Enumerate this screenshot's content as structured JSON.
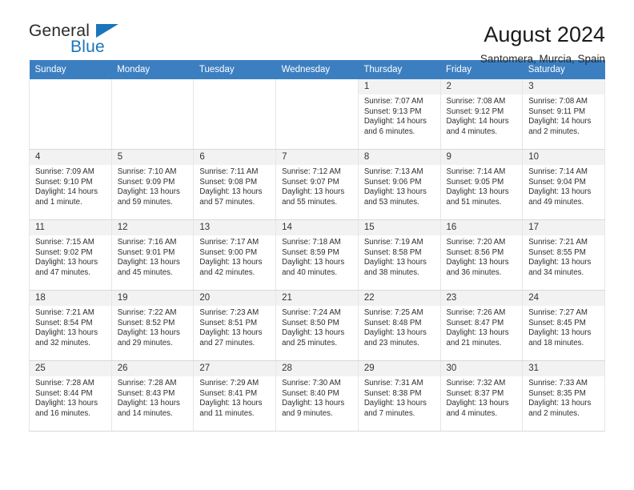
{
  "brand": {
    "word_one": "General",
    "word_two": "Blue",
    "accent_color": "#1b75bb",
    "flag_icon": "brand-flag-icon"
  },
  "header": {
    "title": "August 2024",
    "subtitle": "Santomera, Murcia, Spain",
    "header_bg": "#3c7fc1"
  },
  "calendar": {
    "weekday_headers": [
      "Sunday",
      "Monday",
      "Tuesday",
      "Wednesday",
      "Thursday",
      "Friday",
      "Saturday"
    ],
    "labels": {
      "sunrise": "Sunrise:",
      "sunset": "Sunset:",
      "daylight": "Daylight:"
    },
    "weeks": [
      [
        {
          "day": "",
          "blank": true
        },
        {
          "day": "",
          "blank": true
        },
        {
          "day": "",
          "blank": true
        },
        {
          "day": "",
          "blank": true
        },
        {
          "day": "1",
          "sunrise": "Sunrise: 7:07 AM",
          "sunset": "Sunset: 9:13 PM",
          "daylight_1": "Daylight: 14 hours",
          "daylight_2": "and 6 minutes."
        },
        {
          "day": "2",
          "sunrise": "Sunrise: 7:08 AM",
          "sunset": "Sunset: 9:12 PM",
          "daylight_1": "Daylight: 14 hours",
          "daylight_2": "and 4 minutes."
        },
        {
          "day": "3",
          "sunrise": "Sunrise: 7:08 AM",
          "sunset": "Sunset: 9:11 PM",
          "daylight_1": "Daylight: 14 hours",
          "daylight_2": "and 2 minutes."
        }
      ],
      [
        {
          "day": "4",
          "sunrise": "Sunrise: 7:09 AM",
          "sunset": "Sunset: 9:10 PM",
          "daylight_1": "Daylight: 14 hours",
          "daylight_2": "and 1 minute."
        },
        {
          "day": "5",
          "sunrise": "Sunrise: 7:10 AM",
          "sunset": "Sunset: 9:09 PM",
          "daylight_1": "Daylight: 13 hours",
          "daylight_2": "and 59 minutes."
        },
        {
          "day": "6",
          "sunrise": "Sunrise: 7:11 AM",
          "sunset": "Sunset: 9:08 PM",
          "daylight_1": "Daylight: 13 hours",
          "daylight_2": "and 57 minutes."
        },
        {
          "day": "7",
          "sunrise": "Sunrise: 7:12 AM",
          "sunset": "Sunset: 9:07 PM",
          "daylight_1": "Daylight: 13 hours",
          "daylight_2": "and 55 minutes."
        },
        {
          "day": "8",
          "sunrise": "Sunrise: 7:13 AM",
          "sunset": "Sunset: 9:06 PM",
          "daylight_1": "Daylight: 13 hours",
          "daylight_2": "and 53 minutes."
        },
        {
          "day": "9",
          "sunrise": "Sunrise: 7:14 AM",
          "sunset": "Sunset: 9:05 PM",
          "daylight_1": "Daylight: 13 hours",
          "daylight_2": "and 51 minutes."
        },
        {
          "day": "10",
          "sunrise": "Sunrise: 7:14 AM",
          "sunset": "Sunset: 9:04 PM",
          "daylight_1": "Daylight: 13 hours",
          "daylight_2": "and 49 minutes."
        }
      ],
      [
        {
          "day": "11",
          "sunrise": "Sunrise: 7:15 AM",
          "sunset": "Sunset: 9:02 PM",
          "daylight_1": "Daylight: 13 hours",
          "daylight_2": "and 47 minutes."
        },
        {
          "day": "12",
          "sunrise": "Sunrise: 7:16 AM",
          "sunset": "Sunset: 9:01 PM",
          "daylight_1": "Daylight: 13 hours",
          "daylight_2": "and 45 minutes."
        },
        {
          "day": "13",
          "sunrise": "Sunrise: 7:17 AM",
          "sunset": "Sunset: 9:00 PM",
          "daylight_1": "Daylight: 13 hours",
          "daylight_2": "and 42 minutes."
        },
        {
          "day": "14",
          "sunrise": "Sunrise: 7:18 AM",
          "sunset": "Sunset: 8:59 PM",
          "daylight_1": "Daylight: 13 hours",
          "daylight_2": "and 40 minutes."
        },
        {
          "day": "15",
          "sunrise": "Sunrise: 7:19 AM",
          "sunset": "Sunset: 8:58 PM",
          "daylight_1": "Daylight: 13 hours",
          "daylight_2": "and 38 minutes."
        },
        {
          "day": "16",
          "sunrise": "Sunrise: 7:20 AM",
          "sunset": "Sunset: 8:56 PM",
          "daylight_1": "Daylight: 13 hours",
          "daylight_2": "and 36 minutes."
        },
        {
          "day": "17",
          "sunrise": "Sunrise: 7:21 AM",
          "sunset": "Sunset: 8:55 PM",
          "daylight_1": "Daylight: 13 hours",
          "daylight_2": "and 34 minutes."
        }
      ],
      [
        {
          "day": "18",
          "sunrise": "Sunrise: 7:21 AM",
          "sunset": "Sunset: 8:54 PM",
          "daylight_1": "Daylight: 13 hours",
          "daylight_2": "and 32 minutes."
        },
        {
          "day": "19",
          "sunrise": "Sunrise: 7:22 AM",
          "sunset": "Sunset: 8:52 PM",
          "daylight_1": "Daylight: 13 hours",
          "daylight_2": "and 29 minutes."
        },
        {
          "day": "20",
          "sunrise": "Sunrise: 7:23 AM",
          "sunset": "Sunset: 8:51 PM",
          "daylight_1": "Daylight: 13 hours",
          "daylight_2": "and 27 minutes."
        },
        {
          "day": "21",
          "sunrise": "Sunrise: 7:24 AM",
          "sunset": "Sunset: 8:50 PM",
          "daylight_1": "Daylight: 13 hours",
          "daylight_2": "and 25 minutes."
        },
        {
          "day": "22",
          "sunrise": "Sunrise: 7:25 AM",
          "sunset": "Sunset: 8:48 PM",
          "daylight_1": "Daylight: 13 hours",
          "daylight_2": "and 23 minutes."
        },
        {
          "day": "23",
          "sunrise": "Sunrise: 7:26 AM",
          "sunset": "Sunset: 8:47 PM",
          "daylight_1": "Daylight: 13 hours",
          "daylight_2": "and 21 minutes."
        },
        {
          "day": "24",
          "sunrise": "Sunrise: 7:27 AM",
          "sunset": "Sunset: 8:45 PM",
          "daylight_1": "Daylight: 13 hours",
          "daylight_2": "and 18 minutes."
        }
      ],
      [
        {
          "day": "25",
          "sunrise": "Sunrise: 7:28 AM",
          "sunset": "Sunset: 8:44 PM",
          "daylight_1": "Daylight: 13 hours",
          "daylight_2": "and 16 minutes."
        },
        {
          "day": "26",
          "sunrise": "Sunrise: 7:28 AM",
          "sunset": "Sunset: 8:43 PM",
          "daylight_1": "Daylight: 13 hours",
          "daylight_2": "and 14 minutes."
        },
        {
          "day": "27",
          "sunrise": "Sunrise: 7:29 AM",
          "sunset": "Sunset: 8:41 PM",
          "daylight_1": "Daylight: 13 hours",
          "daylight_2": "and 11 minutes."
        },
        {
          "day": "28",
          "sunrise": "Sunrise: 7:30 AM",
          "sunset": "Sunset: 8:40 PM",
          "daylight_1": "Daylight: 13 hours",
          "daylight_2": "and 9 minutes."
        },
        {
          "day": "29",
          "sunrise": "Sunrise: 7:31 AM",
          "sunset": "Sunset: 8:38 PM",
          "daylight_1": "Daylight: 13 hours",
          "daylight_2": "and 7 minutes."
        },
        {
          "day": "30",
          "sunrise": "Sunrise: 7:32 AM",
          "sunset": "Sunset: 8:37 PM",
          "daylight_1": "Daylight: 13 hours",
          "daylight_2": "and 4 minutes."
        },
        {
          "day": "31",
          "sunrise": "Sunrise: 7:33 AM",
          "sunset": "Sunset: 8:35 PM",
          "daylight_1": "Daylight: 13 hours",
          "daylight_2": "and 2 minutes."
        }
      ]
    ]
  }
}
